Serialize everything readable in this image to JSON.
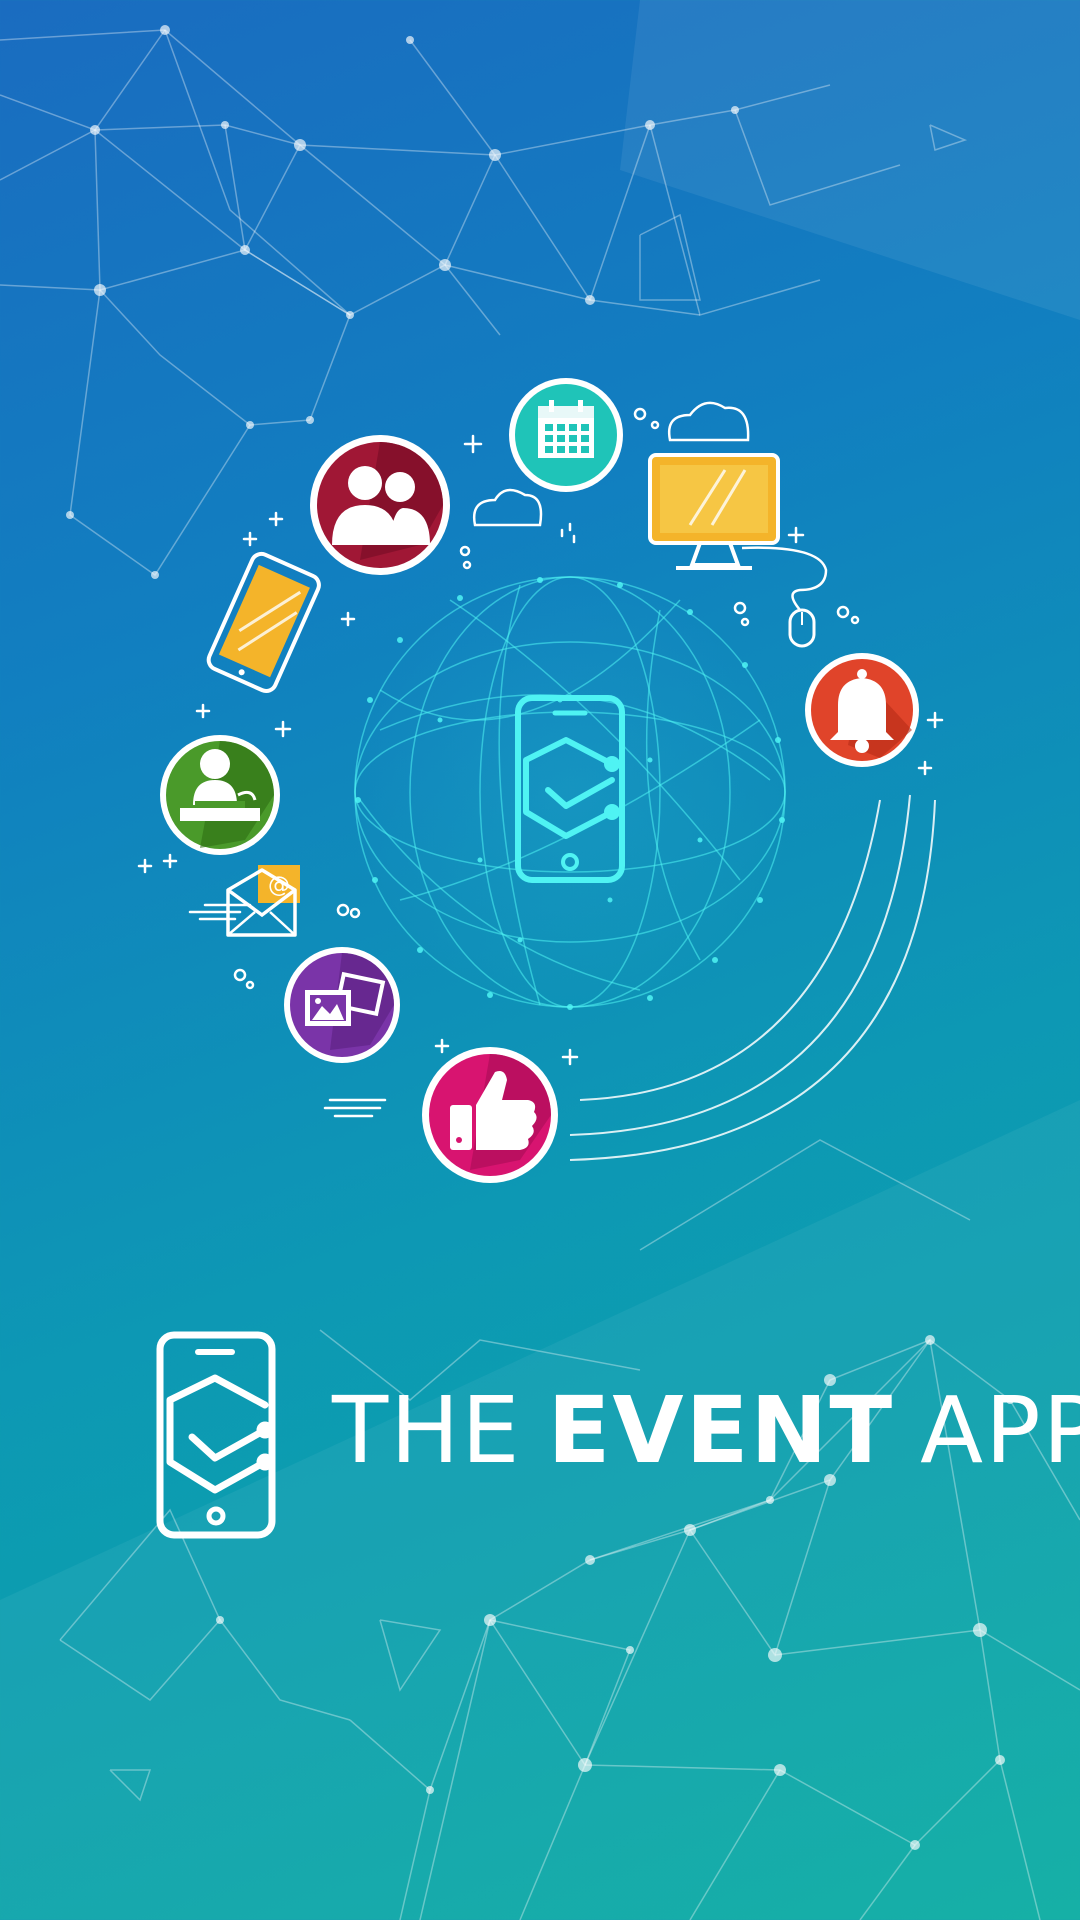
{
  "brand": {
    "word_the": "THE",
    "word_event": "EVENT",
    "word_app": "APP"
  },
  "icons": [
    {
      "name": "attendees-icon",
      "color": "#a01735"
    },
    {
      "name": "calendar-icon",
      "color": "#1fc4b8"
    },
    {
      "name": "desktop-monitor-icon",
      "color": "#f4b42a"
    },
    {
      "name": "notification-bell-icon",
      "color": "#e0442a"
    },
    {
      "name": "like-thumbs-up-icon",
      "color": "#d81470"
    },
    {
      "name": "photo-gallery-icon",
      "color": "#7a34a8"
    },
    {
      "name": "email-icon",
      "color": "#f4b42a"
    },
    {
      "name": "speaker-icon",
      "color": "#4a9a2a"
    },
    {
      "name": "smartphone-icon",
      "color": "#f4b42a"
    }
  ],
  "colors": {
    "background_top": "#1a6cc0",
    "background_bottom": "#0aaca2",
    "globe": "#4ff3f3"
  }
}
